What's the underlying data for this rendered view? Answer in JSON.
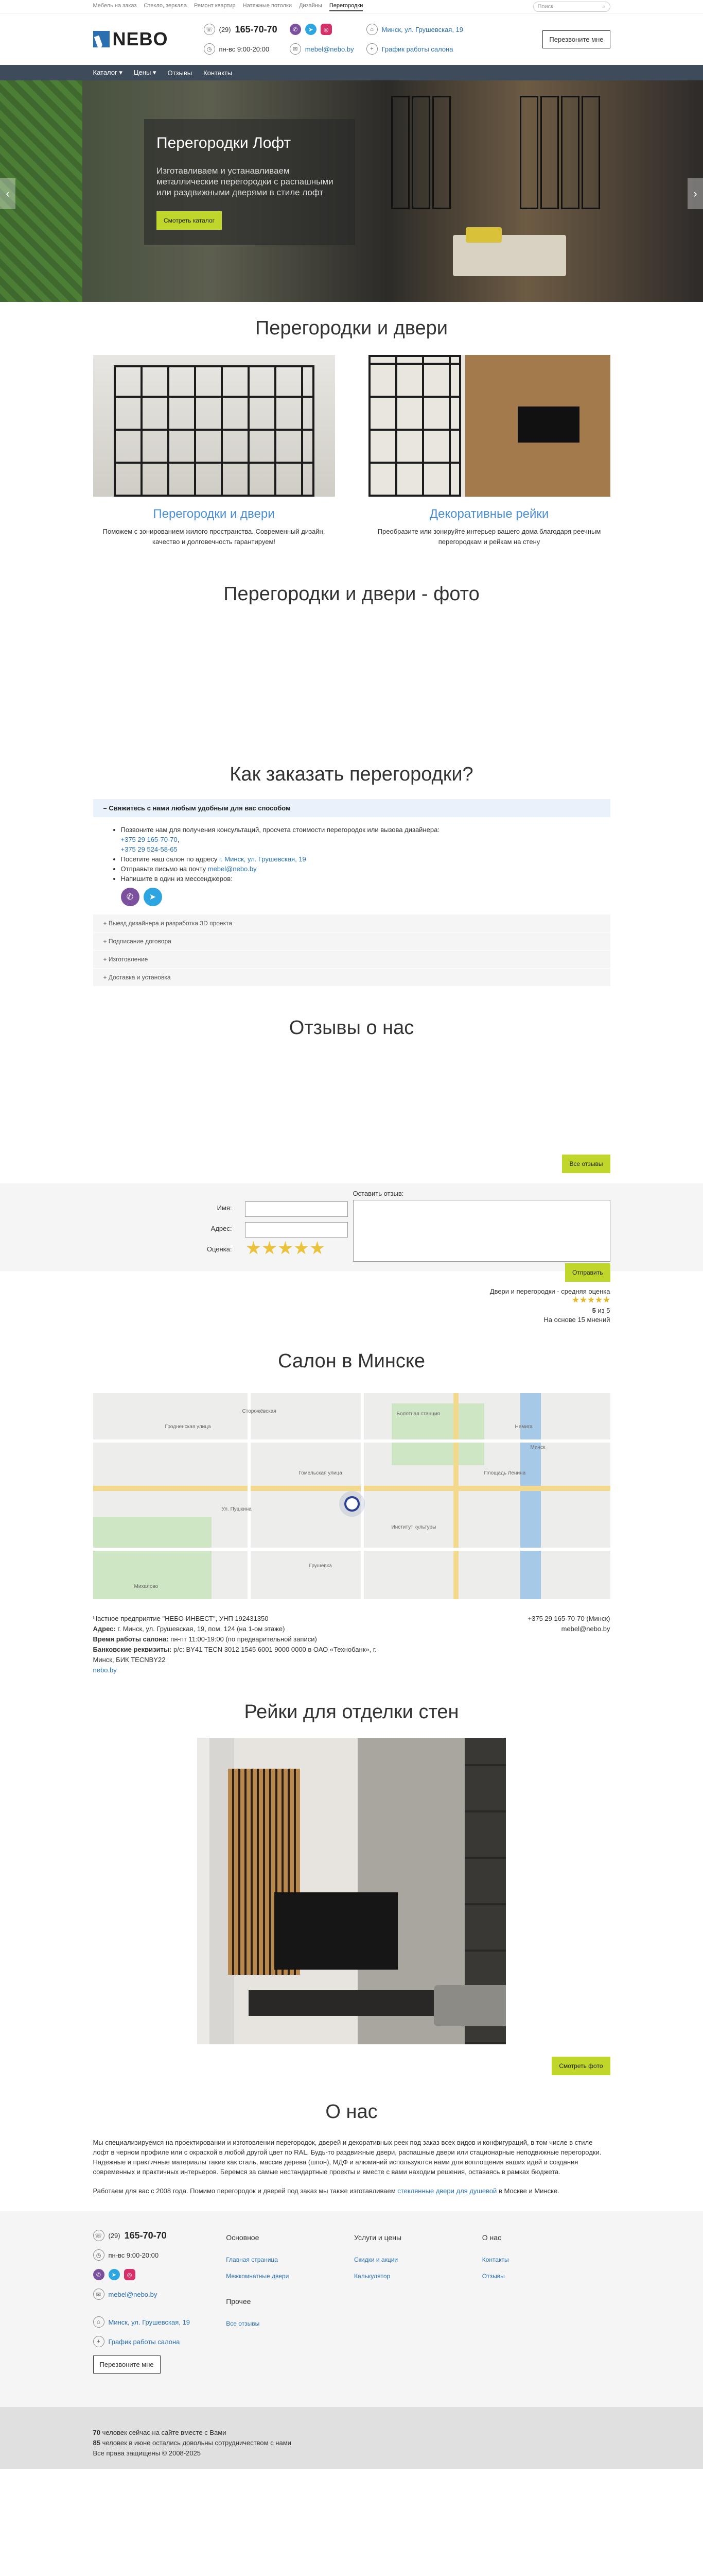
{
  "topnav": {
    "items": [
      "Мебель на заказ",
      "Стекло, зеркала",
      "Ремонт квартир",
      "Натяжные потолки",
      "Дизайны",
      "Перегородки"
    ],
    "search_placeholder": "Поиск"
  },
  "header": {
    "logo": "NEBO",
    "phone_code": "(29)",
    "phone": "165-70-70",
    "hours": "пн-вс 9:00-20:00",
    "address": "Минск, ул. Грушевская, 19",
    "email": "mebel@nebo.by",
    "schedule_link": "График работы салона",
    "call_button": "Перезвоните мне"
  },
  "mainmenu": {
    "items": [
      "Каталог",
      "Цены",
      "Отзывы",
      "Контакты"
    ]
  },
  "hero": {
    "title": "Перегородки Лофт",
    "text": "Изготавливаем и устанавливаем металлические перегородки с распашными или раздвижными дверями в стиле лофт",
    "button": "Смотреть каталог"
  },
  "sections": {
    "partitions_title": "Перегородки и двери",
    "photo_title": "Перегородки и двери - фото",
    "order_title": "Как заказать перегородки?",
    "reviews_title": "Отзывы о нас",
    "salon_title": "Салон в Минске",
    "rails_title": "Рейки для отделки стен",
    "about_title": "О нас"
  },
  "cards": [
    {
      "title": "Перегородки и двери",
      "text": "Поможем с зонированием жилого пространства. Современный дизайн, качество и долговечность гарантируем!"
    },
    {
      "title": "Декоративные рейки",
      "text": "Преобразите или зонируйте интерьер вашего дома благодаря реечным перегородкам и рейкам на стену"
    }
  ],
  "accordion": {
    "open_title": "Свяжитесь с нами любым удобным для вас способом",
    "line1": "Позвоните нам для получения консультаций, просчета стоимости перегородок или вызова дизайнера:",
    "phone1": "+375 29 165-70-70",
    "phone2": "+375 29 524-58-65",
    "line2_prefix": "Посетите наш салон по адресу",
    "line2_link": "г. Минск, ул. Грушевская, 19",
    "line3_prefix": "Отправьте письмо на почту",
    "line3_link": "mebel@nebo.by",
    "line4": "Напишите в один из мессенджеров:",
    "closed": [
      "Выезд дизайнера и разработка 3D проекта",
      "Подписание договора",
      "Изготовление",
      "Доставка и установка"
    ]
  },
  "reviews": {
    "all_button": "Все отзывы",
    "form_title": "Оставить отзыв:",
    "name_label": "Имя:",
    "address_label": "Адрес:",
    "rating_label": "Оценка:",
    "submit": "Отправить",
    "stars_selected": 5
  },
  "rating": {
    "title": "Двери и перегородки - средняя оценка",
    "score": "5",
    "of": "из 5",
    "based": "На основе 15 мнений",
    "stars": 5
  },
  "map": {
    "labels": [
      "Гродненская улица",
      "Сторожёвская",
      "Болотная станция",
      "Немига",
      "Минск",
      "Площадь Ленина",
      "Институт культуры",
      "Гомельская улица",
      "Ул. Пушкина",
      "Грушевка",
      "Михалово"
    ]
  },
  "contacts": {
    "company": "Частное предприятие \"НЕБО-ИНВЕСТ\", УНП 192431350",
    "address_label": "Адрес:",
    "address": "г. Минск, ул. Грушевская, 19, пом. 124 (на 1-ом этаже)",
    "hours_label": "Время работы салона:",
    "hours": "пн-пт 11:00-19:00 (по предварительной записи)",
    "bank_label": "Банковские реквизиты:",
    "bank": "р/с: BY41 TECN 3012 1545 6001 9000 0000 в ОАО «Технобанк», г. Минск, БИК TECNBY22",
    "site": "nebo.by",
    "phone": "+375 29 165-70-70",
    "phone_city": "(Минск)",
    "email": "mebel@nebo.by"
  },
  "rails": {
    "button": "Смотреть фото"
  },
  "about": {
    "p1": "Мы специализируемся на проектировании и изготовлении перегородок, дверей и декоративных реек под заказ всех видов и конфигураций, в том числе в стиле лофт в черном профиле или с окраской в любой другой цвет по RAL. Будь-то раздвижные двери, распашные двери или стационарные неподвижные перегородки. Надежные и практичные материалы такие как сталь, массив дерева (шпон), МДФ и алюминий используются нами для воплощения ваших идей и создания современных и практичных интерьеров. Беремся за самые нестандартные проекты и вместе с вами находим решения, оставаясь в рамках бюджета.",
    "p2_prefix": "Работаем для вас с 2008 года. Помимо перегородок и дверей под заказ мы также изготавливаем",
    "p2_link": "стеклянные двери для душевой",
    "p2_suffix": "в Москве и Минске."
  },
  "footer": {
    "phone_code": "(29)",
    "phone": "165-70-70",
    "hours": "пн-вс 9:00-20:00",
    "email": "mebel@nebo.by",
    "address": "Минск, ул. Грушевская, 19",
    "schedule": "График работы салона",
    "call_button": "Перезвоните мне",
    "col_main_title": "Основное",
    "col_main": [
      "Главная страница",
      "Межкомнатные двери"
    ],
    "col_other_title": "Прочее",
    "col_other": [
      "Все отзывы"
    ],
    "col_services_title": "Услуги и цены",
    "col_services": [
      "Скидки и акции",
      "Калькулятор"
    ],
    "col_about_title": "О нас",
    "col_about": [
      "Контакты",
      "Отзывы"
    ]
  },
  "copyright": {
    "line1_num": "70",
    "line1": "человек сейчас на сайте вместе с Вами",
    "line2_num": "85",
    "line2": "человек в июне остались довольны сотрудничеством с нами",
    "line3": "Все права защищены © 2008-2025"
  },
  "colors": {
    "accent": "#c1d62b",
    "link": "#2a6fb0",
    "menu_bg": "#3e4b5b",
    "card_title": "#4a8fd4"
  }
}
